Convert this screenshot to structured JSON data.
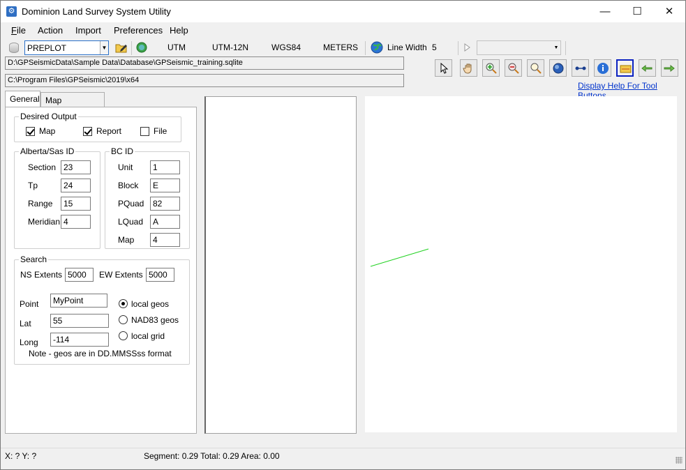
{
  "window": {
    "title": "Dominion Land Survey System Utility",
    "controls": [
      "minimize",
      "maximize",
      "close"
    ]
  },
  "menu": [
    "File",
    "Action",
    "Import",
    "Preferences",
    "Help"
  ],
  "toolbar": {
    "mode_combo": "PREPLOT",
    "buttons": [
      "UTM",
      "UTM-12N",
      "WGS84",
      "METERS"
    ],
    "line_width_label": "Line Width",
    "line_width_value": "5",
    "second_combo": ""
  },
  "paths": {
    "database": "D:\\GPSeismicData\\Sample Data\\Database\\GPSeismic_training.sqlite",
    "install": "C:\\Program Files\\GPSeismic\\2019\\x64"
  },
  "tools": {
    "icons": [
      "pointer-icon",
      "pan-hand-icon",
      "zoom-in-icon",
      "zoom-out-icon",
      "zoom-extents-icon",
      "globe-icon",
      "measure-icon",
      "info-icon",
      "map-view-icon",
      "back-arrow-icon",
      "forward-arrow-icon"
    ],
    "help_link": "Display Help For Tool Buttons"
  },
  "tabs": [
    "General",
    "Map Preferences"
  ],
  "desired_output": {
    "title": "Desired Output",
    "map": {
      "label": "Map",
      "checked": true
    },
    "report": {
      "label": "Report",
      "checked": true
    },
    "file": {
      "label": "File",
      "checked": false
    }
  },
  "alberta": {
    "title": "Alberta/Sas ID",
    "section_label": "Section",
    "section": "23",
    "tp_label": "Tp",
    "tp": "24",
    "range_label": "Range",
    "range": "15",
    "meridian_label": "Meridian",
    "meridian": "4"
  },
  "bc": {
    "title": "BC ID",
    "unit_label": "Unit",
    "unit": "1",
    "block_label": "Block",
    "block": "E",
    "pquad_label": "PQuad",
    "pquad": "82",
    "lquad_label": "LQuad",
    "lquad": "A",
    "map_label": "Map",
    "map": "4"
  },
  "search": {
    "title": "Search",
    "ns_label": "NS Extents",
    "ns": "5000",
    "ew_label": "EW Extents",
    "ew": "5000",
    "point_label": "Point",
    "point": "MyPoint",
    "lat_label": "Lat",
    "lat": "55",
    "long_label": "Long",
    "long": "-114",
    "radio_local_geos": "local geos",
    "radio_nad83": "NAD83 geos",
    "radio_local_grid": "local grid",
    "selected": "local geos",
    "note": "Note - geos are in DD.MMSSss format"
  },
  "map": {
    "line_color": "#1fd11f"
  },
  "status": {
    "xy": "X:  ? Y:  ?",
    "segment": "Segment: 0.29  Total: 0.29  Area: 0.00"
  }
}
